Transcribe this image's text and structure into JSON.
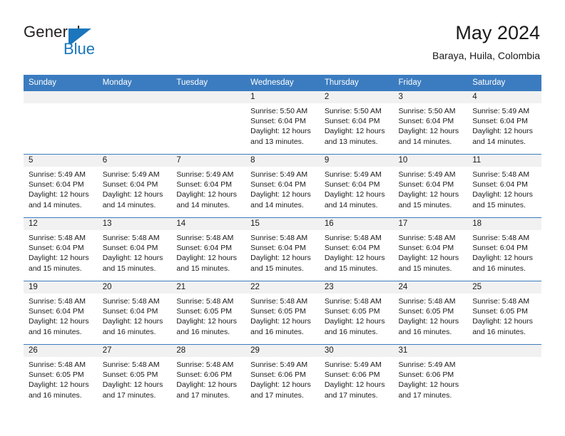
{
  "brand": {
    "name_top": "General",
    "name_bottom": "Blue",
    "mark": "triangle-flag-icon",
    "color_text": "#231f20",
    "color_blue": "#1b76bc"
  },
  "header": {
    "title": "May 2024",
    "subtitle": "Baraya, Huila, Colombia"
  },
  "theme": {
    "header_blue": "#3b7cc0",
    "daynum_band": "#f1f1f1",
    "text": "#1a1a1a"
  },
  "calendar": {
    "weekday_headers": [
      "Sunday",
      "Monday",
      "Tuesday",
      "Wednesday",
      "Thursday",
      "Friday",
      "Saturday"
    ],
    "weeks": [
      [
        {
          "day": "",
          "sunrise": "",
          "sunset": "",
          "daylight_line1": "",
          "daylight_line2": ""
        },
        {
          "day": "",
          "sunrise": "",
          "sunset": "",
          "daylight_line1": "",
          "daylight_line2": ""
        },
        {
          "day": "",
          "sunrise": "",
          "sunset": "",
          "daylight_line1": "",
          "daylight_line2": ""
        },
        {
          "day": "1",
          "sunrise": "Sunrise: 5:50 AM",
          "sunset": "Sunset: 6:04 PM",
          "daylight_line1": "Daylight: 12 hours",
          "daylight_line2": "and 13 minutes."
        },
        {
          "day": "2",
          "sunrise": "Sunrise: 5:50 AM",
          "sunset": "Sunset: 6:04 PM",
          "daylight_line1": "Daylight: 12 hours",
          "daylight_line2": "and 13 minutes."
        },
        {
          "day": "3",
          "sunrise": "Sunrise: 5:50 AM",
          "sunset": "Sunset: 6:04 PM",
          "daylight_line1": "Daylight: 12 hours",
          "daylight_line2": "and 14 minutes."
        },
        {
          "day": "4",
          "sunrise": "Sunrise: 5:49 AM",
          "sunset": "Sunset: 6:04 PM",
          "daylight_line1": "Daylight: 12 hours",
          "daylight_line2": "and 14 minutes."
        }
      ],
      [
        {
          "day": "5",
          "sunrise": "Sunrise: 5:49 AM",
          "sunset": "Sunset: 6:04 PM",
          "daylight_line1": "Daylight: 12 hours",
          "daylight_line2": "and 14 minutes."
        },
        {
          "day": "6",
          "sunrise": "Sunrise: 5:49 AM",
          "sunset": "Sunset: 6:04 PM",
          "daylight_line1": "Daylight: 12 hours",
          "daylight_line2": "and 14 minutes."
        },
        {
          "day": "7",
          "sunrise": "Sunrise: 5:49 AM",
          "sunset": "Sunset: 6:04 PM",
          "daylight_line1": "Daylight: 12 hours",
          "daylight_line2": "and 14 minutes."
        },
        {
          "day": "8",
          "sunrise": "Sunrise: 5:49 AM",
          "sunset": "Sunset: 6:04 PM",
          "daylight_line1": "Daylight: 12 hours",
          "daylight_line2": "and 14 minutes."
        },
        {
          "day": "9",
          "sunrise": "Sunrise: 5:49 AM",
          "sunset": "Sunset: 6:04 PM",
          "daylight_line1": "Daylight: 12 hours",
          "daylight_line2": "and 14 minutes."
        },
        {
          "day": "10",
          "sunrise": "Sunrise: 5:49 AM",
          "sunset": "Sunset: 6:04 PM",
          "daylight_line1": "Daylight: 12 hours",
          "daylight_line2": "and 15 minutes."
        },
        {
          "day": "11",
          "sunrise": "Sunrise: 5:48 AM",
          "sunset": "Sunset: 6:04 PM",
          "daylight_line1": "Daylight: 12 hours",
          "daylight_line2": "and 15 minutes."
        }
      ],
      [
        {
          "day": "12",
          "sunrise": "Sunrise: 5:48 AM",
          "sunset": "Sunset: 6:04 PM",
          "daylight_line1": "Daylight: 12 hours",
          "daylight_line2": "and 15 minutes."
        },
        {
          "day": "13",
          "sunrise": "Sunrise: 5:48 AM",
          "sunset": "Sunset: 6:04 PM",
          "daylight_line1": "Daylight: 12 hours",
          "daylight_line2": "and 15 minutes."
        },
        {
          "day": "14",
          "sunrise": "Sunrise: 5:48 AM",
          "sunset": "Sunset: 6:04 PM",
          "daylight_line1": "Daylight: 12 hours",
          "daylight_line2": "and 15 minutes."
        },
        {
          "day": "15",
          "sunrise": "Sunrise: 5:48 AM",
          "sunset": "Sunset: 6:04 PM",
          "daylight_line1": "Daylight: 12 hours",
          "daylight_line2": "and 15 minutes."
        },
        {
          "day": "16",
          "sunrise": "Sunrise: 5:48 AM",
          "sunset": "Sunset: 6:04 PM",
          "daylight_line1": "Daylight: 12 hours",
          "daylight_line2": "and 15 minutes."
        },
        {
          "day": "17",
          "sunrise": "Sunrise: 5:48 AM",
          "sunset": "Sunset: 6:04 PM",
          "daylight_line1": "Daylight: 12 hours",
          "daylight_line2": "and 15 minutes."
        },
        {
          "day": "18",
          "sunrise": "Sunrise: 5:48 AM",
          "sunset": "Sunset: 6:04 PM",
          "daylight_line1": "Daylight: 12 hours",
          "daylight_line2": "and 16 minutes."
        }
      ],
      [
        {
          "day": "19",
          "sunrise": "Sunrise: 5:48 AM",
          "sunset": "Sunset: 6:04 PM",
          "daylight_line1": "Daylight: 12 hours",
          "daylight_line2": "and 16 minutes."
        },
        {
          "day": "20",
          "sunrise": "Sunrise: 5:48 AM",
          "sunset": "Sunset: 6:04 PM",
          "daylight_line1": "Daylight: 12 hours",
          "daylight_line2": "and 16 minutes."
        },
        {
          "day": "21",
          "sunrise": "Sunrise: 5:48 AM",
          "sunset": "Sunset: 6:05 PM",
          "daylight_line1": "Daylight: 12 hours",
          "daylight_line2": "and 16 minutes."
        },
        {
          "day": "22",
          "sunrise": "Sunrise: 5:48 AM",
          "sunset": "Sunset: 6:05 PM",
          "daylight_line1": "Daylight: 12 hours",
          "daylight_line2": "and 16 minutes."
        },
        {
          "day": "23",
          "sunrise": "Sunrise: 5:48 AM",
          "sunset": "Sunset: 6:05 PM",
          "daylight_line1": "Daylight: 12 hours",
          "daylight_line2": "and 16 minutes."
        },
        {
          "day": "24",
          "sunrise": "Sunrise: 5:48 AM",
          "sunset": "Sunset: 6:05 PM",
          "daylight_line1": "Daylight: 12 hours",
          "daylight_line2": "and 16 minutes."
        },
        {
          "day": "25",
          "sunrise": "Sunrise: 5:48 AM",
          "sunset": "Sunset: 6:05 PM",
          "daylight_line1": "Daylight: 12 hours",
          "daylight_line2": "and 16 minutes."
        }
      ],
      [
        {
          "day": "26",
          "sunrise": "Sunrise: 5:48 AM",
          "sunset": "Sunset: 6:05 PM",
          "daylight_line1": "Daylight: 12 hours",
          "daylight_line2": "and 16 minutes."
        },
        {
          "day": "27",
          "sunrise": "Sunrise: 5:48 AM",
          "sunset": "Sunset: 6:05 PM",
          "daylight_line1": "Daylight: 12 hours",
          "daylight_line2": "and 17 minutes."
        },
        {
          "day": "28",
          "sunrise": "Sunrise: 5:48 AM",
          "sunset": "Sunset: 6:06 PM",
          "daylight_line1": "Daylight: 12 hours",
          "daylight_line2": "and 17 minutes."
        },
        {
          "day": "29",
          "sunrise": "Sunrise: 5:49 AM",
          "sunset": "Sunset: 6:06 PM",
          "daylight_line1": "Daylight: 12 hours",
          "daylight_line2": "and 17 minutes."
        },
        {
          "day": "30",
          "sunrise": "Sunrise: 5:49 AM",
          "sunset": "Sunset: 6:06 PM",
          "daylight_line1": "Daylight: 12 hours",
          "daylight_line2": "and 17 minutes."
        },
        {
          "day": "31",
          "sunrise": "Sunrise: 5:49 AM",
          "sunset": "Sunset: 6:06 PM",
          "daylight_line1": "Daylight: 12 hours",
          "daylight_line2": "and 17 minutes."
        },
        {
          "day": "",
          "sunrise": "",
          "sunset": "",
          "daylight_line1": "",
          "daylight_line2": ""
        }
      ]
    ]
  }
}
